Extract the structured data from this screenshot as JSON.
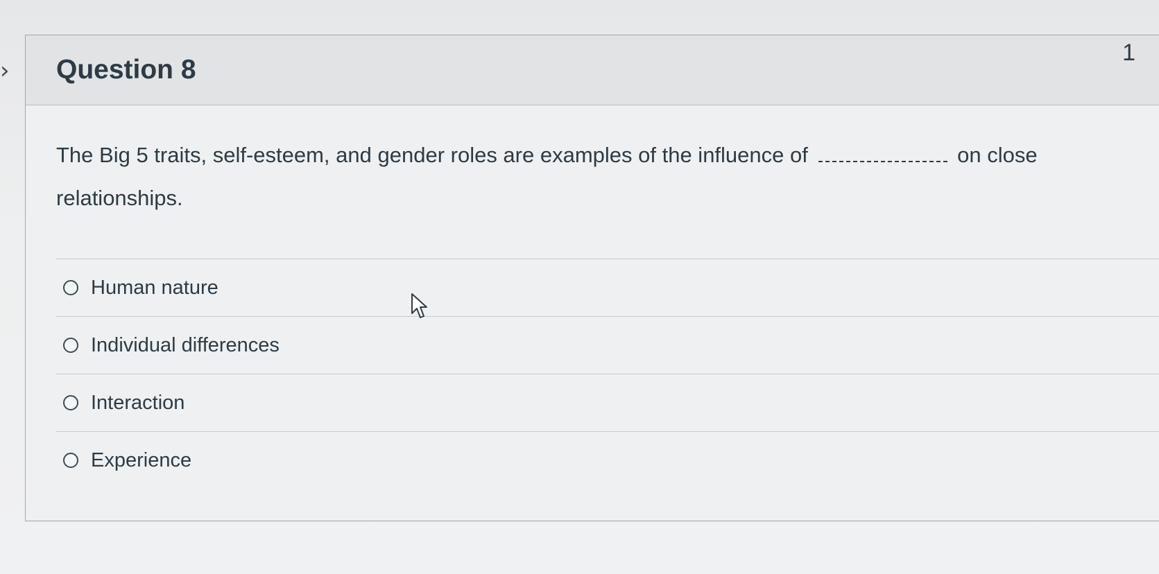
{
  "question": {
    "title": "Question 8",
    "points": "1",
    "text_before": "The Big 5 traits, self-esteem, and gender roles are examples of the influence of",
    "text_after": "on close relationships."
  },
  "answers": [
    {
      "label": "Human nature"
    },
    {
      "label": "Individual differences"
    },
    {
      "label": "Interaction"
    },
    {
      "label": "Experience"
    }
  ],
  "icons": {
    "collapse_toggle": "chevron-right-icon",
    "cursor": "mouse-pointer-icon"
  },
  "colors": {
    "text": "#2d3b45",
    "header_bg": "#e2e3e5",
    "border": "#9ea6ad"
  }
}
